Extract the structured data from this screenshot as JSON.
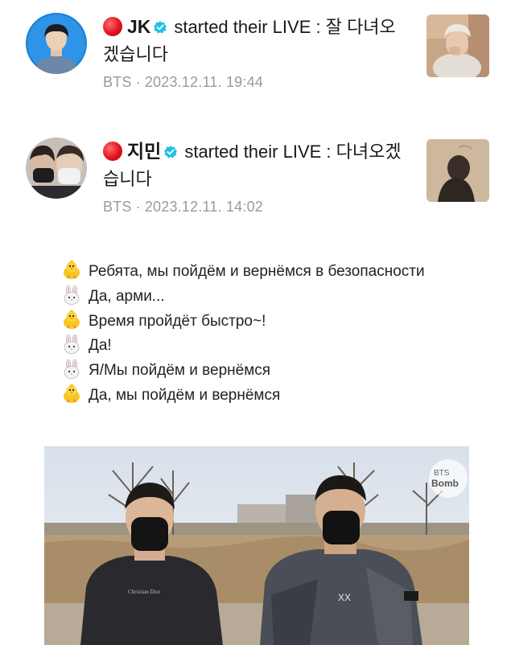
{
  "notifications": [
    {
      "author": "JK",
      "action": "started their LIVE : 잘 다녀오겠습니다",
      "group": "BTS",
      "separator": "·",
      "timestamp": "2023.12.11. 19:44"
    },
    {
      "author": "지민",
      "action": "started their LIVE : 다녀오겠습니다",
      "group": "BTS",
      "separator": "·",
      "timestamp": "2023.12.11. 14:02"
    }
  ],
  "dialogue": [
    {
      "speaker_icon": "chick-icon",
      "text": "Ребята, мы пойдём и вернёмся в безопасности"
    },
    {
      "speaker_icon": "bunny-icon",
      "text": "Да, арми..."
    },
    {
      "speaker_icon": "chick-icon",
      "text": "Время пройдёт быстро~!"
    },
    {
      "speaker_icon": "bunny-icon",
      "text": "Да!"
    },
    {
      "speaker_icon": "bunny-icon",
      "text": "Я/Мы пойдём и вернёмся"
    },
    {
      "speaker_icon": "chick-icon",
      "text": "Да, мы пойдём и вернёмся"
    }
  ],
  "photo": {
    "watermark": "BTS Bomb",
    "colors": {
      "sky": "#dfe6ee",
      "field": "#b69c78",
      "jacket_left": "#2a2a2e",
      "jacket_right": "#4a4e56"
    }
  },
  "colors": {
    "live_dot": "#e0141e",
    "verified": "#1ec2e6",
    "meta_text": "#9a9a9a"
  }
}
